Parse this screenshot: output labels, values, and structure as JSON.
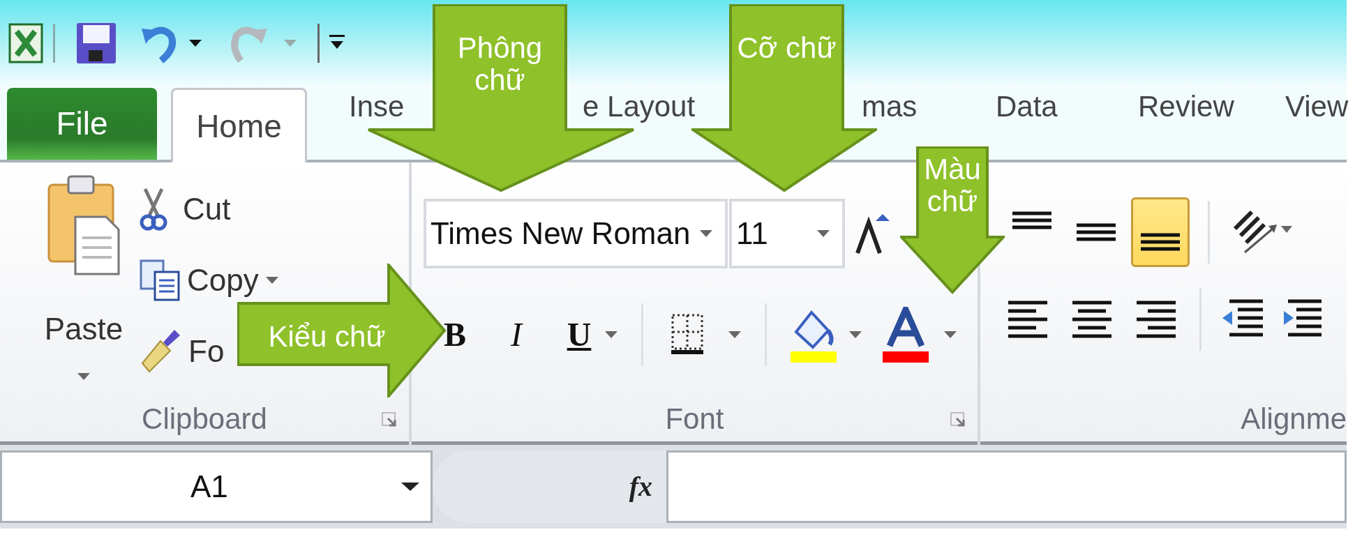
{
  "tabs": [
    {
      "label": "File",
      "kind": "file",
      "selected": false
    },
    {
      "label": "Home",
      "kind": "tab",
      "selected": true
    },
    {
      "label": "Inse",
      "kind": "tab",
      "selected": false
    },
    {
      "label": "e Layout",
      "kind": "tab",
      "selected": false
    },
    {
      "label": "mas",
      "kind": "tab",
      "selected": false
    },
    {
      "label": "Data",
      "kind": "tab",
      "selected": false
    },
    {
      "label": "Review",
      "kind": "tab",
      "selected": false
    },
    {
      "label": "View",
      "kind": "tab",
      "selected": false
    }
  ],
  "clipboard": {
    "paste": "Paste",
    "cut": "Cut",
    "copy": "Copy",
    "format_painter": "Fo",
    "group_label": "Clipboard"
  },
  "font": {
    "font_name": "Times New Roman",
    "font_size": "11",
    "bold": "B",
    "italic": "I",
    "underline": "U",
    "group_label": "Font"
  },
  "alignment": {
    "vertical": [
      {
        "selected": false
      },
      {
        "selected": false
      },
      {
        "selected": true
      }
    ],
    "group_label": "Alignme"
  },
  "formula_bar": {
    "name_box": "A1",
    "fx": "fx"
  },
  "callouts": [
    {
      "kind": "down",
      "text": "Phông chữ"
    },
    {
      "kind": "down",
      "text": "Cỡ chữ"
    },
    {
      "kind": "down",
      "text": "Màu chữ"
    },
    {
      "kind": "right",
      "text": "Kiểu chữ"
    }
  ]
}
